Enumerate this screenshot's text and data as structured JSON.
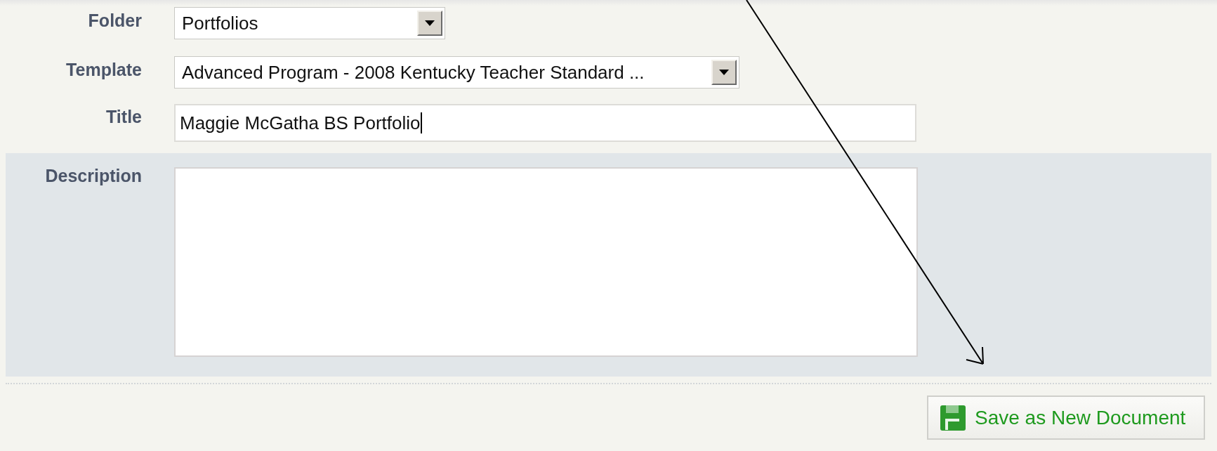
{
  "fields": [
    {
      "kind": "select",
      "label": "Folder",
      "value": "Portfolios"
    },
    {
      "kind": "select",
      "label": "Template",
      "value": "Advanced Program - 2008 Kentucky Teacher Standard ..."
    },
    {
      "kind": "text",
      "label": "Title",
      "value": "Maggie McGatha BS Portfolio"
    },
    {
      "kind": "textarea",
      "label": "Description"
    }
  ],
  "save_button": {
    "label": "Save as New Document"
  }
}
